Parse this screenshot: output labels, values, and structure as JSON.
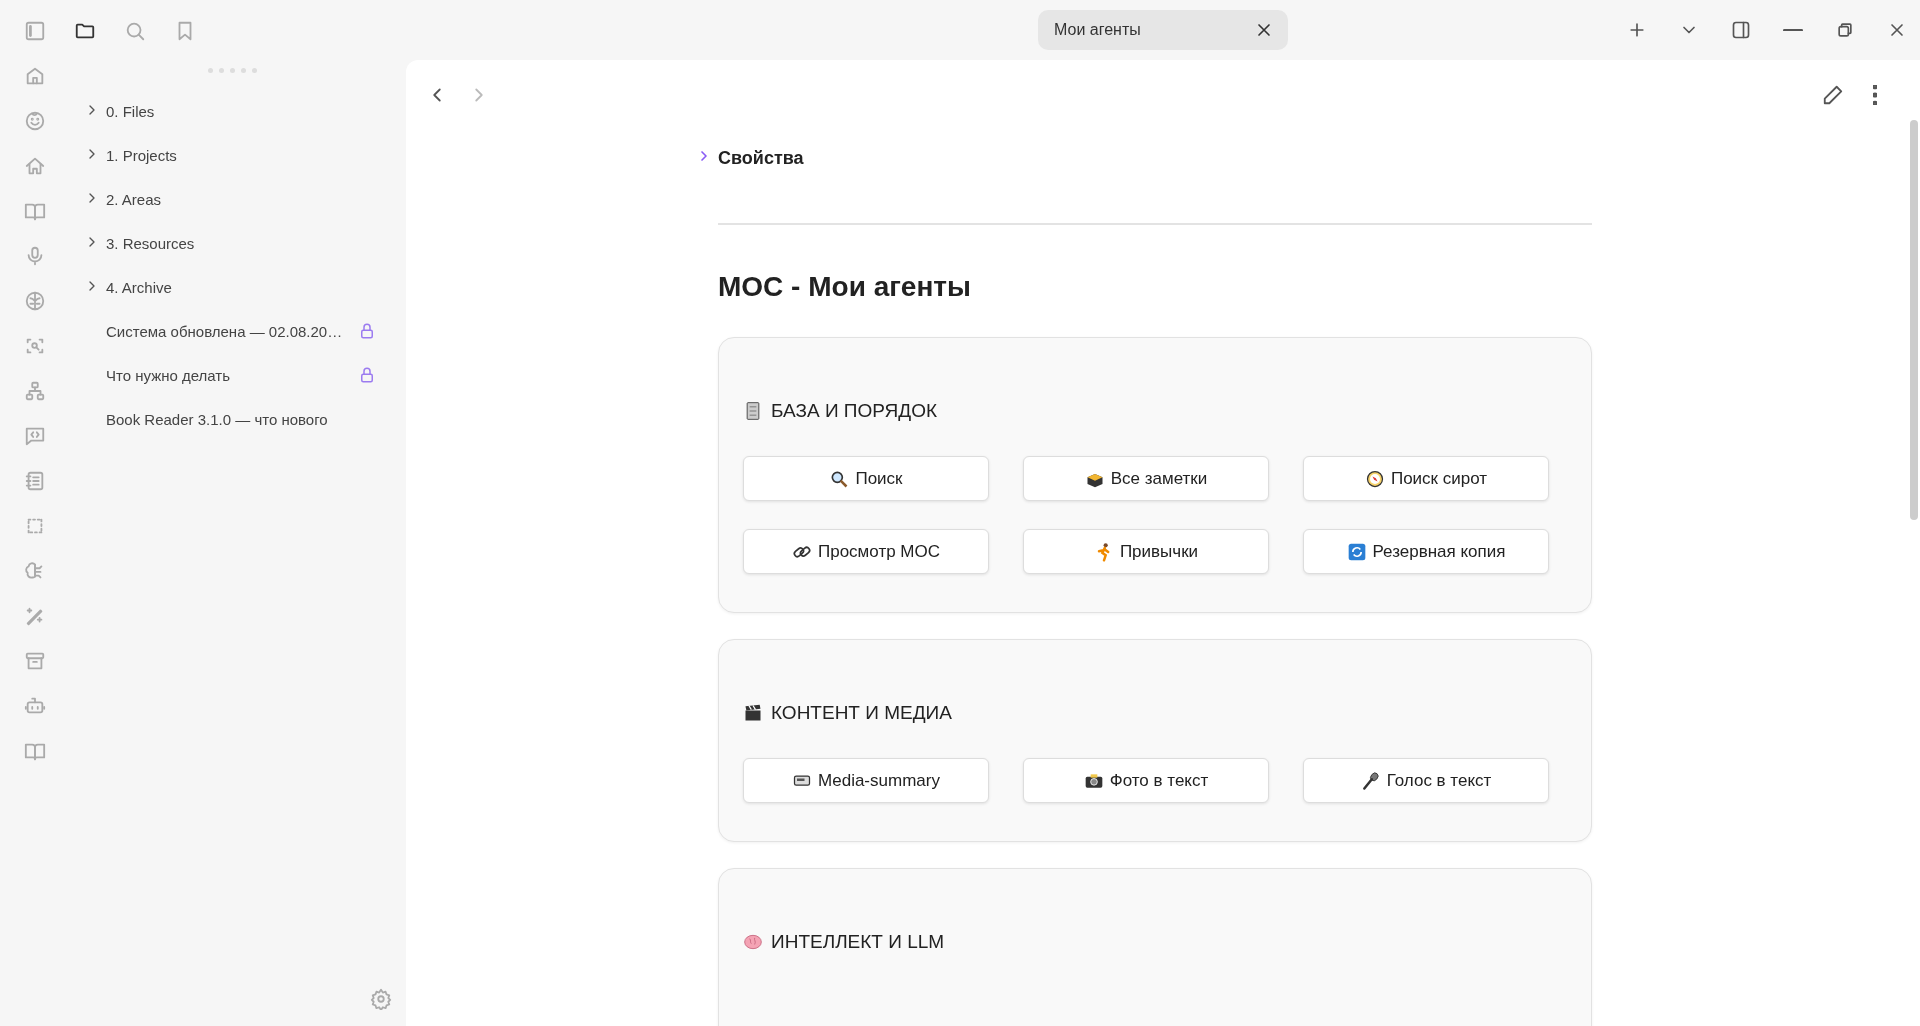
{
  "sidebar_tabs": [
    {
      "selected": true
    },
    {
      "selected": false
    },
    {
      "selected": false
    }
  ],
  "file_tree": {
    "items": [
      {
        "label": "0. Files",
        "kind": "folder",
        "expanded": false
      },
      {
        "label": "1. Projects",
        "kind": "folder",
        "expanded": false
      },
      {
        "label": "2. Areas",
        "kind": "folder",
        "expanded": false
      },
      {
        "label": "3. Resources",
        "kind": "folder",
        "expanded": false
      },
      {
        "label": "4. Archive",
        "kind": "folder",
        "expanded": false
      },
      {
        "label": "Система обновлена — 02.08.20…",
        "kind": "file",
        "locked": true
      },
      {
        "label": "Что нужно делать",
        "kind": "file",
        "locked": true
      },
      {
        "label": "Book Reader 3.1.0 — что нового",
        "kind": "file",
        "locked": false
      }
    ]
  },
  "tab": {
    "title": "Мои агенты"
  },
  "navigation": {
    "back_disabled": false,
    "forward_disabled": true
  },
  "note": {
    "properties": {
      "label": "Свойства",
      "expanded": false
    },
    "title": "MOC - Мои агенты",
    "sections": [
      {
        "heading": "БАЗА И ПОРЯДОК",
        "buttons": [
          "Поиск",
          "Все заметки",
          "Поиск сирот",
          "Просмотр MOC",
          "Привычки",
          "Резервная копия"
        ]
      },
      {
        "heading": "КОНТЕНТ И МЕДИА",
        "buttons": [
          "Media-summary",
          "Фото в текст",
          "Голос в текст"
        ]
      },
      {
        "heading": "ИНТЕЛЛЕКТ И LLM"
      }
    ]
  }
}
